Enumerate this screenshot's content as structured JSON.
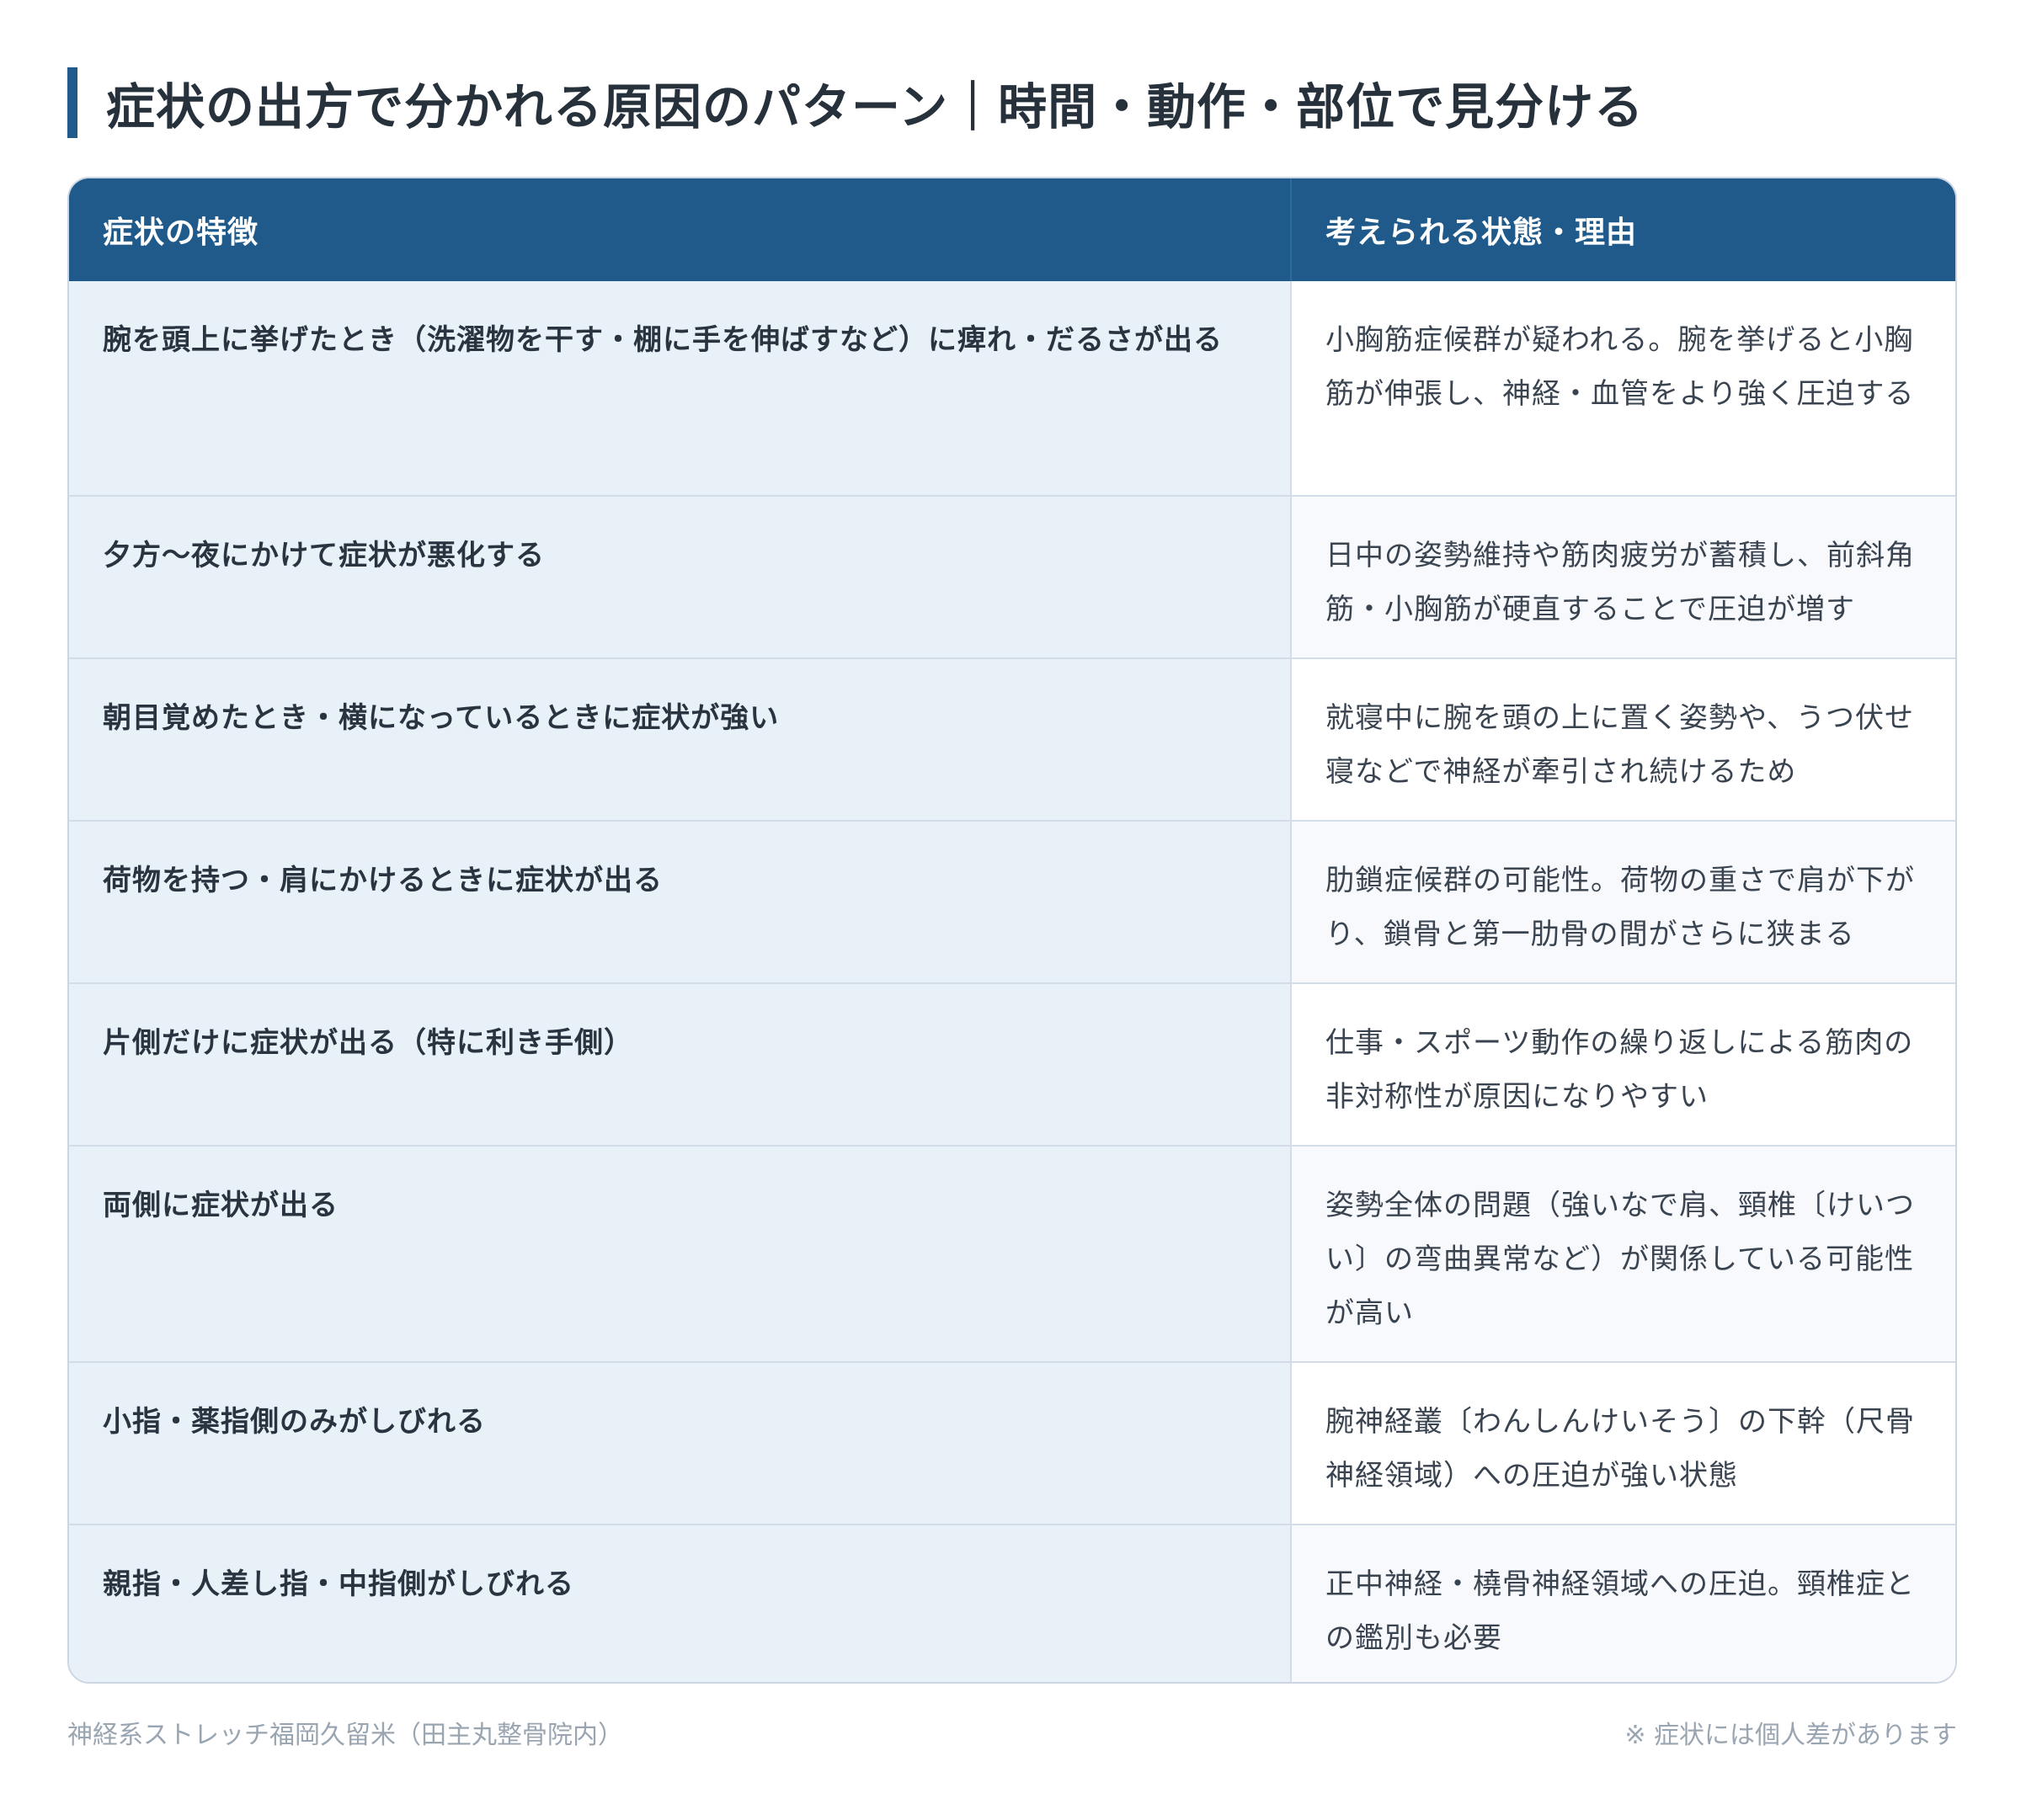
{
  "title": "症状の出方で分かれる原因のパターン｜時間・動作・部位で見分ける",
  "table": {
    "headers": [
      "症状の特徴",
      "考えられる状態・理由"
    ],
    "rows": [
      {
        "symptom": "腕を頭上に挙げたとき（洗濯物を干す・棚に手を伸ばすなど）に痺れ・だるさが出る",
        "reason": "小胸筋症候群が疑われる。腕を挙げると小胸筋が伸張し、神経・血管をより強く圧迫する"
      },
      {
        "symptom": "夕方〜夜にかけて症状が悪化する",
        "reason": "日中の姿勢維持や筋肉疲労が蓄積し、前斜角筋・小胸筋が硬直することで圧迫が増す"
      },
      {
        "symptom": "朝目覚めたとき・横になっているときに症状が強い",
        "reason": "就寝中に腕を頭の上に置く姿勢や、うつ伏せ寝などで神経が牽引され続けるため"
      },
      {
        "symptom": "荷物を持つ・肩にかけるときに症状が出る",
        "reason": "肋鎖症候群の可能性。荷物の重さで肩が下がり、鎖骨と第一肋骨の間がさらに狭まる"
      },
      {
        "symptom": "片側だけに症状が出る（特に利き手側）",
        "reason": "仕事・スポーツ動作の繰り返しによる筋肉の非対称性が原因になりやすい"
      },
      {
        "symptom": "両側に症状が出る",
        "reason": "姿勢全体の問題（強いなで肩、頸椎〔けいつい〕の弯曲異常など）が関係している可能性が高い"
      },
      {
        "symptom": "小指・薬指側のみがしびれる",
        "reason": "腕神経叢〔わんしんけいそう〕の下幹（尺骨神経領域）への圧迫が強い状態"
      },
      {
        "symptom": "親指・人差し指・中指側がしびれる",
        "reason": "正中神経・橈骨神経領域への圧迫。頸椎症との鑑別も必要"
      }
    ]
  },
  "footer": {
    "source": "神経系ストレッチ福岡久留米（田主丸整骨院内）",
    "note": "※ 症状には個人差があります"
  },
  "colors": {
    "accent": "#1f5a8b",
    "left_cell_bg": "#e8f0f8",
    "border": "#d3dde8",
    "footer_text": "#9aa5b2"
  }
}
